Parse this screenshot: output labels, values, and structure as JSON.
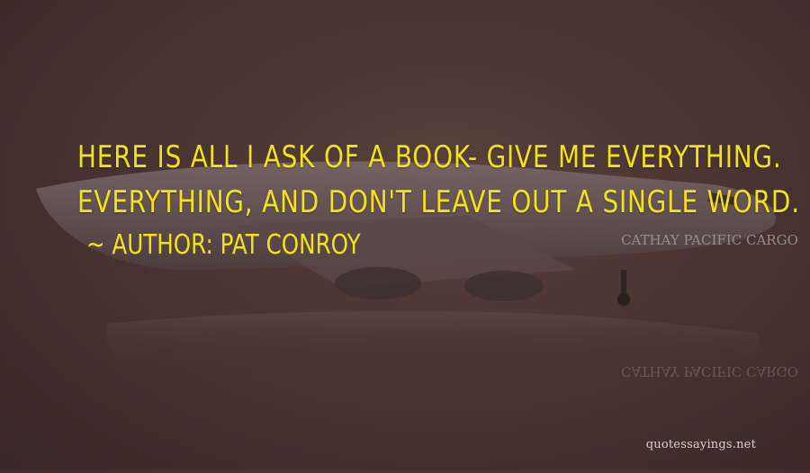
{
  "quote": {
    "lines": [
      "HERE IS ALL I ASK OF A BOOK- GIVE ME EVERYTHING.",
      "EVERYTHING, AND DON'T LEAVE OUT A SINGLE WORD."
    ]
  },
  "author": {
    "text": "~ AUTHOR: PAT CONROY"
  },
  "plane": {
    "livery": "CATHAY PACIFIC CARGO",
    "reflection": "CATHAY PACIFIC CARGO"
  },
  "watermark": {
    "text": "quotessayings.net"
  },
  "colors": {
    "text": "#f2e21a",
    "background": "#4a3431"
  }
}
